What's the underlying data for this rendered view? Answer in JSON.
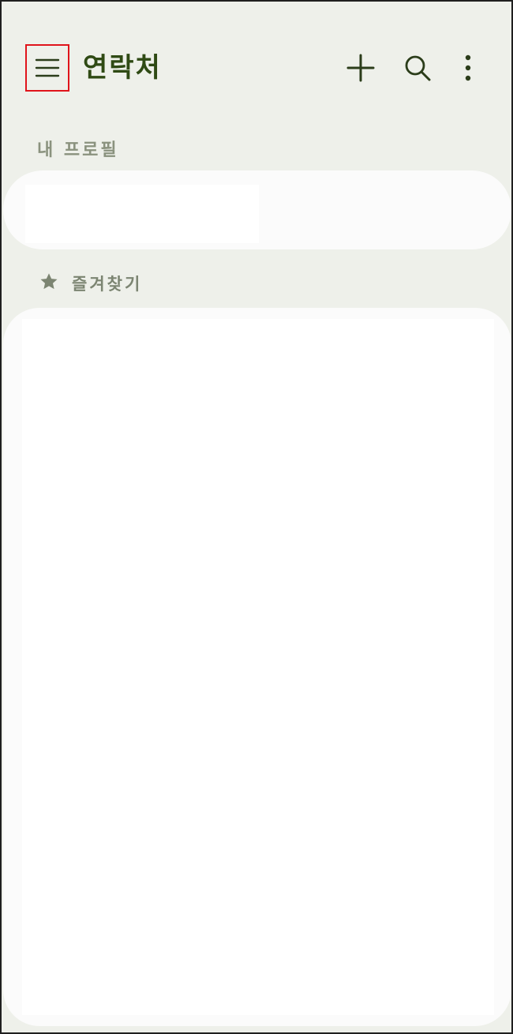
{
  "header": {
    "title": "연락처",
    "menu_icon": "hamburger-menu-icon",
    "add_icon": "plus-icon",
    "search_icon": "search-icon",
    "more_icon": "more-vertical-icon"
  },
  "sections": {
    "profile_label": "내 프로필",
    "favorites_label": "즐겨찾기",
    "favorites_icon": "star-icon"
  },
  "colors": {
    "background": "#eef0ea",
    "title": "#2f4a14",
    "icon": "#2b3d1a",
    "section_label": "#8a927e",
    "highlight_border": "#e0141b"
  }
}
